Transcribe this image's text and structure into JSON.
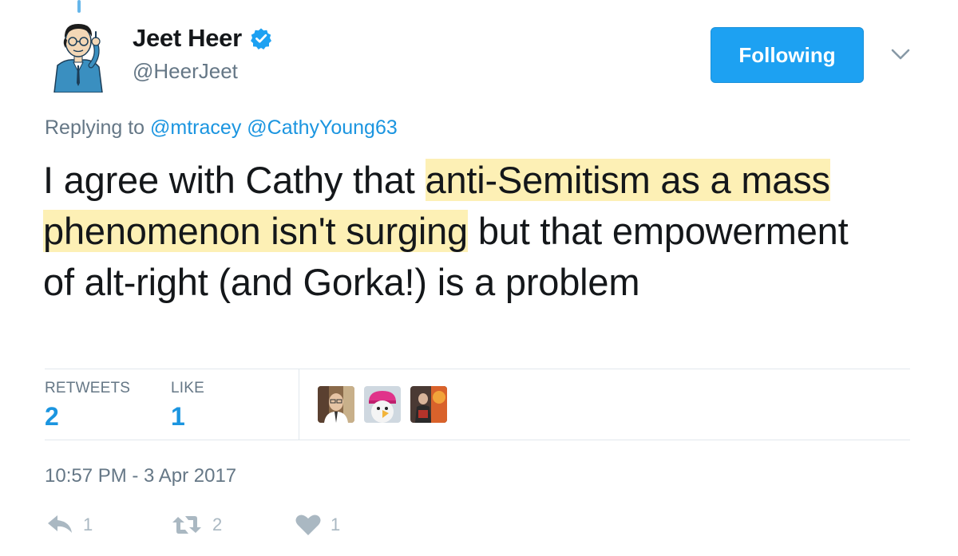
{
  "author": {
    "display_name": "Jeet Heer",
    "handle": "@HeerJeet",
    "verified": true
  },
  "follow_button": {
    "label": "Following"
  },
  "reply_context": {
    "prefix": "Replying to",
    "mentions": [
      "@mtracey",
      "@CathyYoung63"
    ]
  },
  "tweet": {
    "text_before": "I agree with Cathy that ",
    "text_highlighted": "anti-Semitism as a mass phenomenon isn't surging",
    "text_after": " but that empowerment of alt-right (and Gorka!) is a problem"
  },
  "stats": {
    "retweets_label": "RETWEETS",
    "retweets_count": "2",
    "likes_label": "LIKE",
    "likes_count": "1"
  },
  "likers": [
    {
      "name": "liker-avatar-man-glasses"
    },
    {
      "name": "liker-avatar-eagle-pink-hat"
    },
    {
      "name": "liker-avatar-fire-scene"
    }
  ],
  "timestamp": "10:57 PM - 3 Apr 2017",
  "actions": {
    "reply_count": "1",
    "retweet_count": "2",
    "like_count": "1"
  },
  "colors": {
    "accent": "#1da1f2",
    "link": "#1b95e0",
    "muted": "#657786",
    "highlight": "#fdf0b5"
  }
}
